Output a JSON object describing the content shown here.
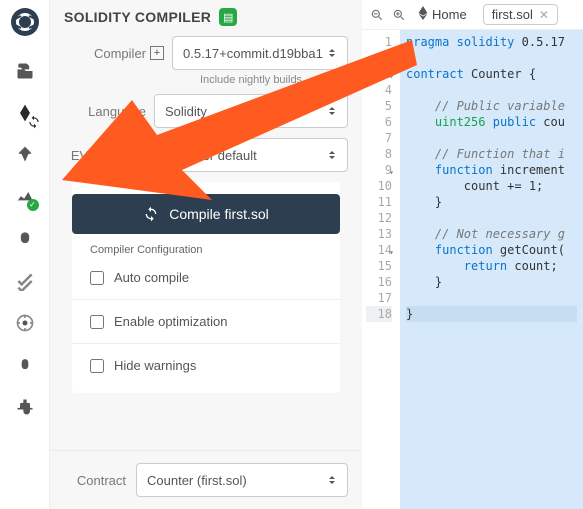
{
  "panel": {
    "title": "SOLIDITY COMPILER",
    "labels": {
      "compiler": "Compiler",
      "language": "Language",
      "evm": "EVM Version",
      "contract": "Contract"
    },
    "compiler_value": "0.5.17+commit.d19bba1",
    "include_nightly": "Include nightly builds",
    "language_value": "Solidity",
    "evm_value": "compiler default",
    "compile_label": "Compile first.sol",
    "config_header": "Compiler Configuration",
    "checks": {
      "auto": "Auto compile",
      "optimize": "Enable optimization",
      "hide": "Hide warnings"
    },
    "contract_value": "Counter (first.sol)"
  },
  "tabs": {
    "home": "Home",
    "active": "first.sol"
  },
  "code": {
    "lines": [
      "pragma solidity 0.5.17",
      "",
      "contract Counter {",
      "",
      "    // Public variable",
      "    uint256 public cou",
      "",
      "    // Function that i",
      "    function increment",
      "        count += 1;",
      "    }",
      "",
      "    // Not necessary g",
      "    function getCount(",
      "        return count;",
      "    }",
      "",
      "}"
    ],
    "fold_lines": [
      3,
      9,
      14
    ]
  }
}
